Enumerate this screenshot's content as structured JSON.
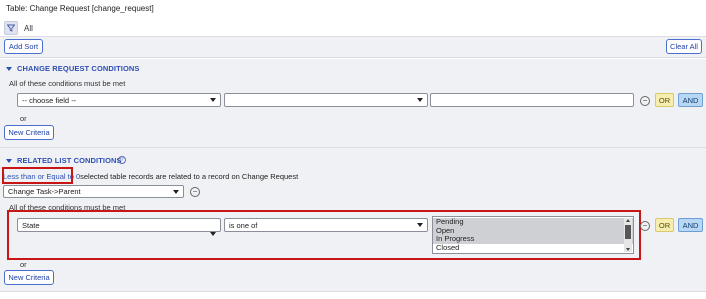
{
  "header": {
    "title": "Table: Change Request [change_request]"
  },
  "filter": {
    "all_label": "All"
  },
  "toolbar": {
    "add_sort": "Add Sort",
    "clear_all": "Clear All"
  },
  "cr_conditions": {
    "heading": "CHANGE REQUEST CONDITIONS",
    "subtitle": "All of these conditions must be met",
    "field_placeholder": "-- choose field --",
    "operator_value": "",
    "value_text": "",
    "or_label": "OR",
    "and_label": "AND",
    "or_text": "or",
    "new_criteria": "New Criteria"
  },
  "related": {
    "heading": "RELATED LIST CONDITIONS",
    "quantifier": "Less than or Equal to 0",
    "description": "selected table records are related to a record on Change Request",
    "relation": "Change Task->Parent",
    "subtitle": "All of these conditions must be met",
    "field": "State",
    "operator": "is one of",
    "options": [
      {
        "label": "Pending",
        "selected": true
      },
      {
        "label": "Open",
        "selected": true
      },
      {
        "label": "In Progress",
        "selected": true
      },
      {
        "label": "Closed",
        "selected": false
      }
    ],
    "or_label": "OR",
    "and_label": "AND",
    "or_text": "or",
    "new_criteria": "New Criteria"
  },
  "icons": {
    "filter": "funnel-icon",
    "remove": "minus-circle-icon",
    "info": "help-icon",
    "collapse": "triangle-down-icon"
  },
  "colors": {
    "accent": "#2d4fb5",
    "highlight": "#c81616",
    "or_button": "#f6edb0",
    "and_button": "#b8d7f4"
  }
}
